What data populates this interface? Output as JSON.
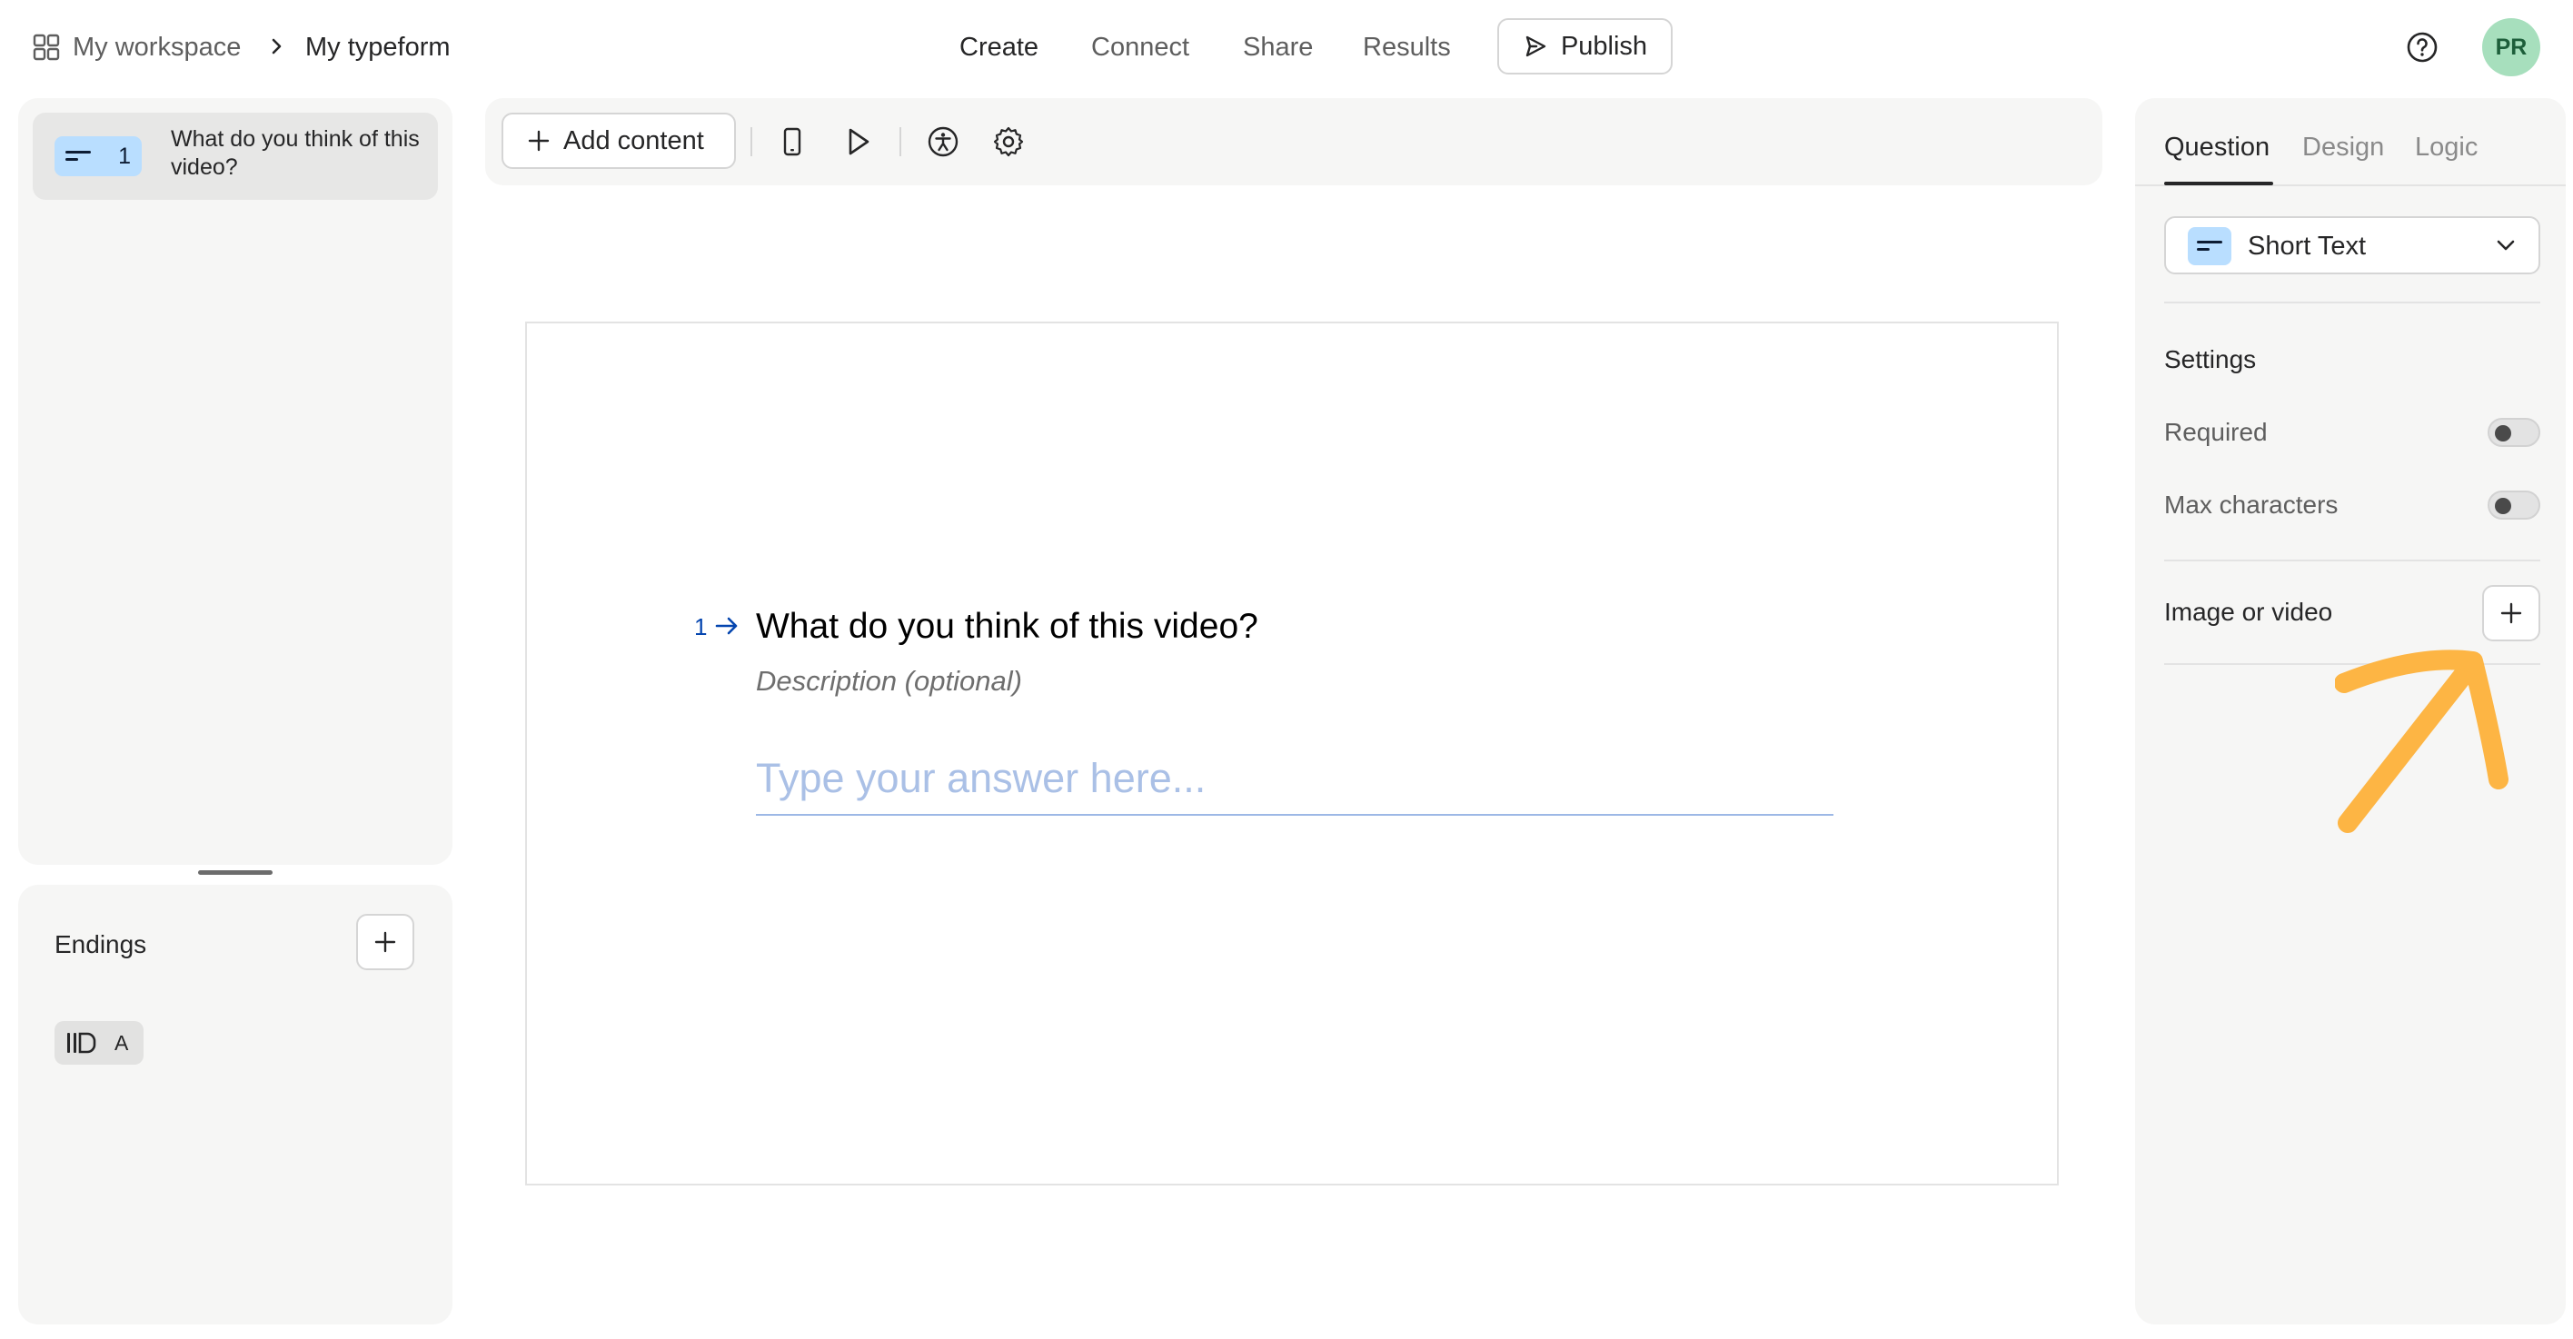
{
  "breadcrumb": {
    "workspace": "My workspace",
    "separator": "›",
    "form": "My typeform"
  },
  "nav": {
    "create": "Create",
    "connect": "Connect",
    "share": "Share",
    "results": "Results",
    "publish": "Publish"
  },
  "user": {
    "initials": "PR"
  },
  "sidebar": {
    "questions": [
      {
        "number": "1",
        "title": "What do you think of this video?",
        "type_icon": "short-text-icon"
      }
    ],
    "endings_label": "Endings",
    "endings": [
      {
        "letter": "A",
        "icon": "ending-icon"
      }
    ]
  },
  "toolbar": {
    "add_content": "Add content",
    "icons": [
      "mobile-preview-icon",
      "play-icon",
      "accessibility-icon",
      "gear-icon"
    ]
  },
  "canvas": {
    "question_number": "1",
    "question_title": "What do you think of this video?",
    "description_placeholder": "Description (optional)",
    "answer_placeholder": "Type your answer here..."
  },
  "right_panel": {
    "tabs": [
      "Question",
      "Design",
      "Logic"
    ],
    "active_tab": "Question",
    "question_type": "Short Text",
    "settings_heading": "Settings",
    "required_label": "Required",
    "required_on": false,
    "max_chars_label": "Max characters",
    "max_chars_on": false,
    "media_label": "Image or video"
  },
  "colors": {
    "accent_blue": "#0445af",
    "badge_blue": "#b9deff",
    "avatar_green": "#a7dfbd",
    "annotation_orange": "#fdb544"
  }
}
